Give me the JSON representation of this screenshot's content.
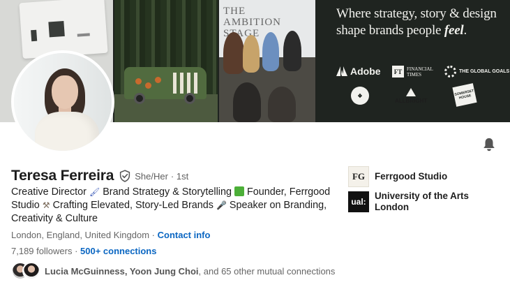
{
  "banner": {
    "tagline_part1": "Where strategy, story & design shape brands people",
    "tagline_emph": "feel",
    "tagline_end": ".",
    "stage_title": "THE AMBITION STAGE",
    "logos": {
      "adobe": "Adobe",
      "ft_box": "FT",
      "ft_text": "FINANCIAL TIMES",
      "global_goals": "THE GLOBAL GOALS",
      "allbright": "ALLBRIGHT",
      "somerset": "SOMERSET HOUSE"
    }
  },
  "profile": {
    "name": "Teresa Ferreira",
    "pronouns": "She/Her",
    "degree": "· 1st",
    "headline_1": "Creative Director ",
    "headline_2": " Brand Strategy & Storytelling ",
    "headline_3": " Founder, Ferrgood Studio ",
    "headline_4": " Crafting Elevated, Story-Led Brands ",
    "headline_5": " Speaker on Branding, Creativity & Culture",
    "location": "London, England, United Kingdom",
    "separator": " · ",
    "contact_info": "Contact info",
    "followers": "7,189 followers",
    "follow_sep": " · ",
    "connections": "500+ connections",
    "mutual_names": "Lucia McGuinness, Yoon Jung Choi",
    "mutual_rest": ", and 65 other mutual connections"
  },
  "orgs": [
    {
      "name": "Ferrgood Studio",
      "logo_text": "FG",
      "icon": "ferrgood-logo"
    },
    {
      "name": "University of the Arts London",
      "logo_text": "ual:",
      "icon": "ual-logo"
    }
  ],
  "icons": {
    "bell": "notification-bell-icon",
    "verified": "verified-shield-icon"
  },
  "colors": {
    "link": "#0a66c2",
    "banner_dark": "#1f2420",
    "text": "#1d1d1d",
    "muted": "#666666"
  }
}
